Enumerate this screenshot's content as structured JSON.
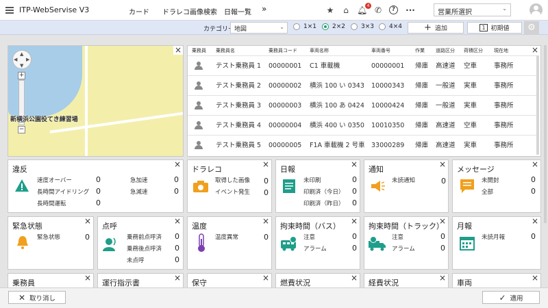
{
  "app": {
    "title": "ITP-WebServise V3"
  },
  "nav": [
    "カード",
    "ドラレコ画像検索",
    "日報一覧"
  ],
  "nav_more": "»",
  "header": {
    "notification_count": "4",
    "office_select": "営業所選択"
  },
  "toolbar": {
    "category_label": "カテゴリー",
    "category_value": "地図",
    "grid_options": [
      "1×1",
      "2×2",
      "3×3",
      "4×4"
    ],
    "grid_selected": "2×2",
    "add_label": "追加",
    "reset_label": "初期値",
    "reset_icon_text": "1"
  },
  "table": {
    "headers": [
      "乗務員",
      "乗務員名",
      "乗務員コード",
      "車両名称",
      "車両番号",
      "作業",
      "道路区分",
      "荷積区分",
      "現在地"
    ],
    "rows": [
      [
        "テスト乗務員 1",
        "00000001",
        "C1 車載機",
        "00000001",
        "帰庫",
        "高速道",
        "空車",
        "事務所"
      ],
      [
        "テスト乗務員 2",
        "00000002",
        "横浜 100 い 0343",
        "10000343",
        "帰庫",
        "一般道",
        "実車",
        "事務所"
      ],
      [
        "テスト乗務員 3",
        "00000003",
        "横浜 100 あ 0424",
        "10000424",
        "帰庫",
        "一般道",
        "実車",
        "事務所"
      ],
      [
        "テスト乗務員 4",
        "00000004",
        "横浜 400 い 0350",
        "10010350",
        "帰庫",
        "高速道",
        "空車",
        "事務所"
      ],
      [
        "テスト乗務員 5",
        "00000005",
        "F1A 車載機 2 号車",
        "33000289",
        "帰庫",
        "高速道",
        "実車",
        "事務所"
      ]
    ]
  },
  "map": {
    "label": "新横浜公園役てき練習場"
  },
  "cards": {
    "violation": {
      "title": "違反",
      "items": [
        [
          "速度オーバー",
          "0"
        ],
        [
          "長時間アイドリング",
          "0"
        ],
        [
          "長時間運転",
          "0"
        ],
        [
          "急加速",
          "0"
        ],
        [
          "急減速",
          "0"
        ]
      ]
    },
    "dashcam": {
      "title": "ドラレコ",
      "items": [
        [
          "取得した画像",
          "0"
        ],
        [
          "イベント発生",
          "0"
        ]
      ]
    },
    "daily": {
      "title": "日報",
      "items": [
        [
          "未印刷",
          "0"
        ],
        [
          "印刷済（今日）",
          "0"
        ],
        [
          "印刷済（昨日）",
          "0"
        ]
      ]
    },
    "notice": {
      "title": "通知",
      "items": [
        [
          "未読通知",
          "0"
        ]
      ]
    },
    "message": {
      "title": "メッセージ",
      "items": [
        [
          "未開封",
          "0"
        ],
        [
          "全部",
          "0"
        ]
      ]
    },
    "emergency": {
      "title": "緊急状態",
      "items": [
        [
          "緊急状態",
          "0"
        ]
      ]
    },
    "rollcall": {
      "title": "点呼",
      "items": [
        [
          "乗務前点呼済",
          "0"
        ],
        [
          "乗務後点呼済",
          "0"
        ],
        [
          "未点呼",
          "0"
        ]
      ]
    },
    "temperature": {
      "title": "温度",
      "items": [
        [
          "温度異常",
          "0"
        ]
      ]
    },
    "bus": {
      "title": "拘束時間（バス）",
      "items": [
        [
          "注意",
          "0"
        ],
        [
          "アラーム",
          "0"
        ]
      ]
    },
    "truck": {
      "title": "拘束時間（トラック）",
      "items": [
        [
          "注意",
          "0"
        ],
        [
          "アラーム",
          "0"
        ]
      ]
    },
    "monthly": {
      "title": "月報",
      "items": [
        [
          "未読月報",
          "0"
        ]
      ]
    },
    "crew": {
      "title": "乗務員"
    },
    "instruction": {
      "title": "運行指示書"
    },
    "maintenance": {
      "title": "保守"
    },
    "fuel": {
      "title": "燃費状況"
    },
    "expense": {
      "title": "経費状況"
    },
    "vehicle": {
      "title": "車両"
    }
  },
  "footer": {
    "cancel_label": "取り消し",
    "apply_label": "適用"
  },
  "colors": {
    "accent_green": "#2a9d6a",
    "icon_orange": "#f0a01e",
    "icon_teal": "#1f9e8a",
    "icon_purple": "#7a3fb0",
    "badge_red": "#d9342b",
    "toolbar_blue": "#dfe6f6"
  }
}
